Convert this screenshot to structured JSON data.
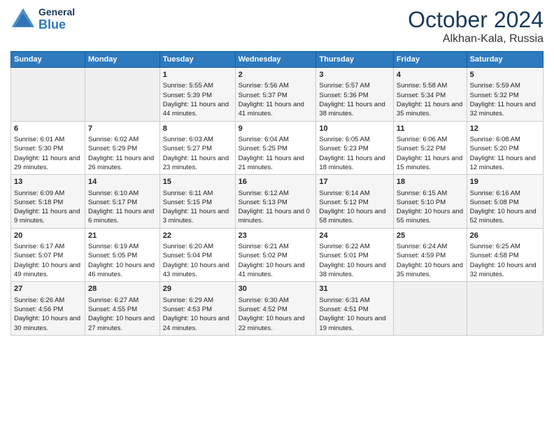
{
  "logo": {
    "general": "General",
    "blue": "Blue"
  },
  "header": {
    "month": "October 2024",
    "location": "Alkhan-Kala, Russia"
  },
  "days_of_week": [
    "Sunday",
    "Monday",
    "Tuesday",
    "Wednesday",
    "Thursday",
    "Friday",
    "Saturday"
  ],
  "weeks": [
    [
      {
        "day": "",
        "sunrise": "",
        "sunset": "",
        "daylight": ""
      },
      {
        "day": "",
        "sunrise": "",
        "sunset": "",
        "daylight": ""
      },
      {
        "day": "1",
        "sunrise": "Sunrise: 5:55 AM",
        "sunset": "Sunset: 5:39 PM",
        "daylight": "Daylight: 11 hours and 44 minutes."
      },
      {
        "day": "2",
        "sunrise": "Sunrise: 5:56 AM",
        "sunset": "Sunset: 5:37 PM",
        "daylight": "Daylight: 11 hours and 41 minutes."
      },
      {
        "day": "3",
        "sunrise": "Sunrise: 5:57 AM",
        "sunset": "Sunset: 5:36 PM",
        "daylight": "Daylight: 11 hours and 38 minutes."
      },
      {
        "day": "4",
        "sunrise": "Sunrise: 5:58 AM",
        "sunset": "Sunset: 5:34 PM",
        "daylight": "Daylight: 11 hours and 35 minutes."
      },
      {
        "day": "5",
        "sunrise": "Sunrise: 5:59 AM",
        "sunset": "Sunset: 5:32 PM",
        "daylight": "Daylight: 11 hours and 32 minutes."
      }
    ],
    [
      {
        "day": "6",
        "sunrise": "Sunrise: 6:01 AM",
        "sunset": "Sunset: 5:30 PM",
        "daylight": "Daylight: 11 hours and 29 minutes."
      },
      {
        "day": "7",
        "sunrise": "Sunrise: 6:02 AM",
        "sunset": "Sunset: 5:29 PM",
        "daylight": "Daylight: 11 hours and 26 minutes."
      },
      {
        "day": "8",
        "sunrise": "Sunrise: 6:03 AM",
        "sunset": "Sunset: 5:27 PM",
        "daylight": "Daylight: 11 hours and 23 minutes."
      },
      {
        "day": "9",
        "sunrise": "Sunrise: 6:04 AM",
        "sunset": "Sunset: 5:25 PM",
        "daylight": "Daylight: 11 hours and 21 minutes."
      },
      {
        "day": "10",
        "sunrise": "Sunrise: 6:05 AM",
        "sunset": "Sunset: 5:23 PM",
        "daylight": "Daylight: 11 hours and 18 minutes."
      },
      {
        "day": "11",
        "sunrise": "Sunrise: 6:06 AM",
        "sunset": "Sunset: 5:22 PM",
        "daylight": "Daylight: 11 hours and 15 minutes."
      },
      {
        "day": "12",
        "sunrise": "Sunrise: 6:08 AM",
        "sunset": "Sunset: 5:20 PM",
        "daylight": "Daylight: 11 hours and 12 minutes."
      }
    ],
    [
      {
        "day": "13",
        "sunrise": "Sunrise: 6:09 AM",
        "sunset": "Sunset: 5:18 PM",
        "daylight": "Daylight: 11 hours and 9 minutes."
      },
      {
        "day": "14",
        "sunrise": "Sunrise: 6:10 AM",
        "sunset": "Sunset: 5:17 PM",
        "daylight": "Daylight: 11 hours and 6 minutes."
      },
      {
        "day": "15",
        "sunrise": "Sunrise: 6:11 AM",
        "sunset": "Sunset: 5:15 PM",
        "daylight": "Daylight: 11 hours and 3 minutes."
      },
      {
        "day": "16",
        "sunrise": "Sunrise: 6:12 AM",
        "sunset": "Sunset: 5:13 PM",
        "daylight": "Daylight: 11 hours and 0 minutes."
      },
      {
        "day": "17",
        "sunrise": "Sunrise: 6:14 AM",
        "sunset": "Sunset: 5:12 PM",
        "daylight": "Daylight: 10 hours and 58 minutes."
      },
      {
        "day": "18",
        "sunrise": "Sunrise: 6:15 AM",
        "sunset": "Sunset: 5:10 PM",
        "daylight": "Daylight: 10 hours and 55 minutes."
      },
      {
        "day": "19",
        "sunrise": "Sunrise: 6:16 AM",
        "sunset": "Sunset: 5:08 PM",
        "daylight": "Daylight: 10 hours and 52 minutes."
      }
    ],
    [
      {
        "day": "20",
        "sunrise": "Sunrise: 6:17 AM",
        "sunset": "Sunset: 5:07 PM",
        "daylight": "Daylight: 10 hours and 49 minutes."
      },
      {
        "day": "21",
        "sunrise": "Sunrise: 6:19 AM",
        "sunset": "Sunset: 5:05 PM",
        "daylight": "Daylight: 10 hours and 46 minutes."
      },
      {
        "day": "22",
        "sunrise": "Sunrise: 6:20 AM",
        "sunset": "Sunset: 5:04 PM",
        "daylight": "Daylight: 10 hours and 43 minutes."
      },
      {
        "day": "23",
        "sunrise": "Sunrise: 6:21 AM",
        "sunset": "Sunset: 5:02 PM",
        "daylight": "Daylight: 10 hours and 41 minutes."
      },
      {
        "day": "24",
        "sunrise": "Sunrise: 6:22 AM",
        "sunset": "Sunset: 5:01 PM",
        "daylight": "Daylight: 10 hours and 38 minutes."
      },
      {
        "day": "25",
        "sunrise": "Sunrise: 6:24 AM",
        "sunset": "Sunset: 4:59 PM",
        "daylight": "Daylight: 10 hours and 35 minutes."
      },
      {
        "day": "26",
        "sunrise": "Sunrise: 6:25 AM",
        "sunset": "Sunset: 4:58 PM",
        "daylight": "Daylight: 10 hours and 32 minutes."
      }
    ],
    [
      {
        "day": "27",
        "sunrise": "Sunrise: 6:26 AM",
        "sunset": "Sunset: 4:56 PM",
        "daylight": "Daylight: 10 hours and 30 minutes."
      },
      {
        "day": "28",
        "sunrise": "Sunrise: 6:27 AM",
        "sunset": "Sunset: 4:55 PM",
        "daylight": "Daylight: 10 hours and 27 minutes."
      },
      {
        "day": "29",
        "sunrise": "Sunrise: 6:29 AM",
        "sunset": "Sunset: 4:53 PM",
        "daylight": "Daylight: 10 hours and 24 minutes."
      },
      {
        "day": "30",
        "sunrise": "Sunrise: 6:30 AM",
        "sunset": "Sunset: 4:52 PM",
        "daylight": "Daylight: 10 hours and 22 minutes."
      },
      {
        "day": "31",
        "sunrise": "Sunrise: 6:31 AM",
        "sunset": "Sunset: 4:51 PM",
        "daylight": "Daylight: 10 hours and 19 minutes."
      },
      {
        "day": "",
        "sunrise": "",
        "sunset": "",
        "daylight": ""
      },
      {
        "day": "",
        "sunrise": "",
        "sunset": "",
        "daylight": ""
      }
    ]
  ]
}
